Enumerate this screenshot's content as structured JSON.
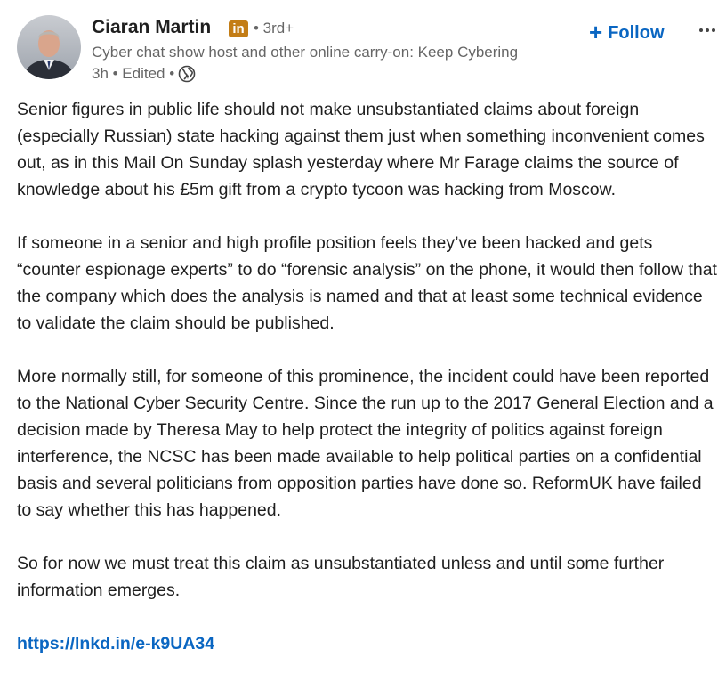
{
  "author": {
    "name": "Ciaran Martin",
    "badge": "in",
    "degree": "• 3rd+",
    "headline": "Cyber chat show host and other online carry-on: Keep Cybering",
    "meta": "3h • Edited •"
  },
  "actions": {
    "follow_label": "Follow",
    "follow_icon": "plus-icon",
    "more_icon": "ellipsis-icon"
  },
  "post": {
    "paragraphs": [
      "Senior figures in public life should not make unsubstantiated claims about foreign (especially Russian) state hacking against them just when something inconvenient comes out, as in this Mail On Sunday splash yesterday where Mr Farage claims the source of knowledge about his £5m gift from a crypto tycoon was hacking from Moscow.",
      "If someone in a senior and high profile position feels they’ve been hacked and gets “counter espionage experts” to do “forensic analysis” on the phone, it would then follow that the company which does the analysis is named and that at least some technical evidence to validate the claim should be published.",
      "More normally still, for someone of this prominence, the incident could have been reported to the National Cyber Security Centre. Since the run up to the 2017 General Election and a decision made by Theresa May to help protect the integrity of politics against foreign interference, the NCSC has been made available to help political parties on a confidential basis and several politicians from opposition parties have done so. ReformUK have failed to say whether this has happened.",
      "So for now we must treat this claim as unsubstantiated unless and until some further information emerges."
    ],
    "link": "https://lnkd.in/e-k9UA34"
  },
  "colors": {
    "accent": "#0a66c2",
    "muted": "#666666",
    "badge": "#c37d16"
  }
}
